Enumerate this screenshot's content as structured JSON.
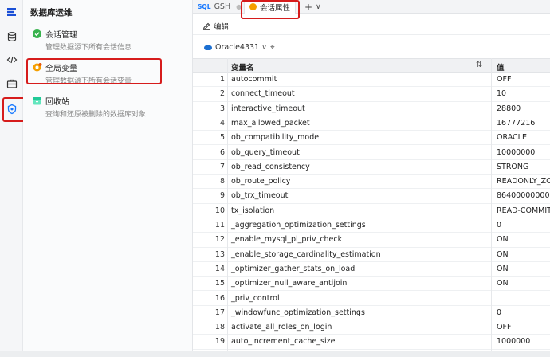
{
  "rail": {
    "icons": [
      "logo-icon",
      "database-icon",
      "code-icon",
      "toolbox-icon",
      "ops-icon"
    ]
  },
  "panel": {
    "title": "数据库运维",
    "items": [
      {
        "title": "会话管理",
        "desc": "管理数据源下所有会话信息"
      },
      {
        "title": "全局变量",
        "desc": "管理数据源下所有会话变量"
      },
      {
        "title": "回收站",
        "desc": "查询和还原被删除的数据库对象"
      }
    ]
  },
  "tabs": {
    "sql_tag": "SQL",
    "sql_tab": "GSH",
    "active_tab": "会话属性",
    "add": "+",
    "more": "∨"
  },
  "toolbar": {
    "edit_label": "编辑"
  },
  "datasource": {
    "name": "Oracle4331",
    "chevron": "∨"
  },
  "table": {
    "col_name": "变量名",
    "col_value": "值",
    "rows": [
      {
        "n": "1",
        "name": "autocommit",
        "value": "OFF"
      },
      {
        "n": "2",
        "name": "connect_timeout",
        "value": "10"
      },
      {
        "n": "3",
        "name": "interactive_timeout",
        "value": "28800"
      },
      {
        "n": "4",
        "name": "max_allowed_packet",
        "value": "16777216"
      },
      {
        "n": "5",
        "name": "ob_compatibility_mode",
        "value": "ORACLE"
      },
      {
        "n": "6",
        "name": "ob_query_timeout",
        "value": "10000000"
      },
      {
        "n": "7",
        "name": "ob_read_consistency",
        "value": "STRONG"
      },
      {
        "n": "8",
        "name": "ob_route_policy",
        "value": "READONLY_ZO"
      },
      {
        "n": "9",
        "name": "ob_trx_timeout",
        "value": "86400000000"
      },
      {
        "n": "10",
        "name": "tx_isolation",
        "value": "READ-COMMIT"
      },
      {
        "n": "11",
        "name": "_aggregation_optimization_settings",
        "value": "0"
      },
      {
        "n": "12",
        "name": "_enable_mysql_pl_priv_check",
        "value": "ON"
      },
      {
        "n": "13",
        "name": "_enable_storage_cardinality_estimation",
        "value": "ON"
      },
      {
        "n": "14",
        "name": "_optimizer_gather_stats_on_load",
        "value": "ON"
      },
      {
        "n": "15",
        "name": "_optimizer_null_aware_antijoin",
        "value": "ON"
      },
      {
        "n": "16",
        "name": "_priv_control",
        "value": ""
      },
      {
        "n": "17",
        "name": "_windowfunc_optimization_settings",
        "value": "0"
      },
      {
        "n": "18",
        "name": "activate_all_roles_on_login",
        "value": "OFF"
      },
      {
        "n": "19",
        "name": "auto_increment_cache_size",
        "value": "1000000"
      }
    ]
  },
  "colors": {
    "accent": "#1677ff",
    "highlight": "#d61c1c"
  }
}
